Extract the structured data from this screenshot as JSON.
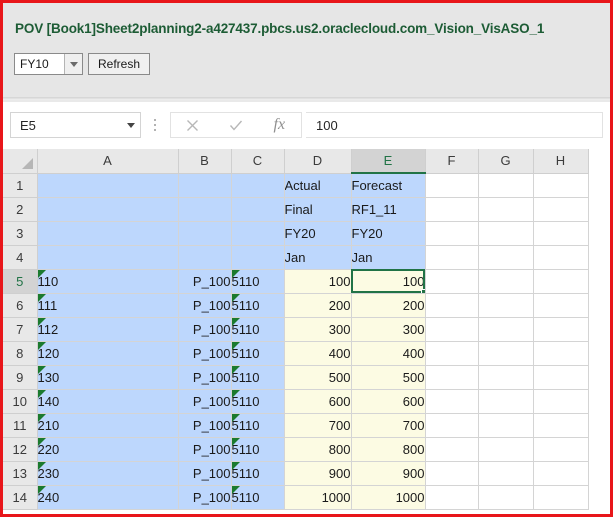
{
  "pov": {
    "title": "POV [Book1]Sheet2planning2-a427437.pbcs.us2.oraclecloud.com_Vision_VisASO_1",
    "combo_value": "FY10",
    "combo_arrow_icon": "chevron-down-icon",
    "refresh_label": "Refresh"
  },
  "formula_bar": {
    "name_box_value": "E5",
    "name_box_arrow_icon": "chevron-down-icon",
    "cancel_icon": "close-icon",
    "enter_icon": "check-icon",
    "function_icon": "fx-icon",
    "formula_value": "100",
    "formula_placeholder": ""
  },
  "grid": {
    "column_headers": [
      "A",
      "B",
      "C",
      "D",
      "E",
      "F",
      "G",
      "H"
    ],
    "selected_column": "E",
    "selected_row": "5",
    "selected_cell": "E5",
    "row_numbers": [
      "1",
      "2",
      "3",
      "4",
      "5",
      "6",
      "7",
      "8",
      "9",
      "10",
      "11",
      "12",
      "13",
      "14"
    ],
    "rows": [
      {
        "num": "1",
        "cells": [
          {
            "col": "A",
            "value": "",
            "fill": "blue",
            "align": "lt",
            "note": false
          },
          {
            "col": "B",
            "value": "",
            "fill": "blue",
            "align": "lt",
            "note": false
          },
          {
            "col": "C",
            "value": "",
            "fill": "blue",
            "align": "lt",
            "note": false
          },
          {
            "col": "D",
            "value": "Actual",
            "fill": "blue",
            "align": "lt",
            "note": false
          },
          {
            "col": "E",
            "value": "Forecast",
            "fill": "blue",
            "align": "lt",
            "note": false
          },
          {
            "col": "F",
            "value": "",
            "fill": "plain",
            "align": "lt",
            "note": false
          },
          {
            "col": "G",
            "value": "",
            "fill": "plain",
            "align": "lt",
            "note": false
          },
          {
            "col": "H",
            "value": "",
            "fill": "plain",
            "align": "lt",
            "note": false
          }
        ]
      },
      {
        "num": "2",
        "cells": [
          {
            "col": "A",
            "value": "",
            "fill": "blue",
            "align": "lt",
            "note": false
          },
          {
            "col": "B",
            "value": "",
            "fill": "blue",
            "align": "lt",
            "note": false
          },
          {
            "col": "C",
            "value": "",
            "fill": "blue",
            "align": "lt",
            "note": false
          },
          {
            "col": "D",
            "value": "Final",
            "fill": "blue",
            "align": "lt",
            "note": false
          },
          {
            "col": "E",
            "value": "RF1_11",
            "fill": "blue",
            "align": "lt",
            "note": false
          },
          {
            "col": "F",
            "value": "",
            "fill": "plain",
            "align": "lt",
            "note": false
          },
          {
            "col": "G",
            "value": "",
            "fill": "plain",
            "align": "lt",
            "note": false
          },
          {
            "col": "H",
            "value": "",
            "fill": "plain",
            "align": "lt",
            "note": false
          }
        ]
      },
      {
        "num": "3",
        "cells": [
          {
            "col": "A",
            "value": "",
            "fill": "blue",
            "align": "lt",
            "note": false
          },
          {
            "col": "B",
            "value": "",
            "fill": "blue",
            "align": "lt",
            "note": false
          },
          {
            "col": "C",
            "value": "",
            "fill": "blue",
            "align": "lt",
            "note": false
          },
          {
            "col": "D",
            "value": "FY20",
            "fill": "blue",
            "align": "lt",
            "note": false
          },
          {
            "col": "E",
            "value": "FY20",
            "fill": "blue",
            "align": "lt",
            "note": false
          },
          {
            "col": "F",
            "value": "",
            "fill": "plain",
            "align": "lt",
            "note": false
          },
          {
            "col": "G",
            "value": "",
            "fill": "plain",
            "align": "lt",
            "note": false
          },
          {
            "col": "H",
            "value": "",
            "fill": "plain",
            "align": "lt",
            "note": false
          }
        ]
      },
      {
        "num": "4",
        "cells": [
          {
            "col": "A",
            "value": "",
            "fill": "blue",
            "align": "lt",
            "note": false
          },
          {
            "col": "B",
            "value": "",
            "fill": "blue",
            "align": "lt",
            "note": false
          },
          {
            "col": "C",
            "value": "",
            "fill": "blue",
            "align": "lt",
            "note": false
          },
          {
            "col": "D",
            "value": "Jan",
            "fill": "blue",
            "align": "lt",
            "note": false
          },
          {
            "col": "E",
            "value": "Jan",
            "fill": "blue",
            "align": "lt",
            "note": false
          },
          {
            "col": "F",
            "value": "",
            "fill": "plain",
            "align": "lt",
            "note": false
          },
          {
            "col": "G",
            "value": "",
            "fill": "plain",
            "align": "lt",
            "note": false
          },
          {
            "col": "H",
            "value": "",
            "fill": "plain",
            "align": "lt",
            "note": false
          }
        ]
      },
      {
        "num": "5",
        "cells": [
          {
            "col": "A",
            "value": "110",
            "fill": "blue",
            "align": "lt",
            "note": true
          },
          {
            "col": "B",
            "value": "P_100",
            "fill": "blue",
            "align": "rt",
            "note": false
          },
          {
            "col": "C",
            "value": "5110",
            "fill": "blue",
            "align": "lt",
            "note": true
          },
          {
            "col": "D",
            "value": "100",
            "fill": "yellow",
            "align": "rt",
            "note": false
          },
          {
            "col": "E",
            "value": "100",
            "fill": "yellow",
            "align": "rt",
            "note": false,
            "selected": true
          },
          {
            "col": "F",
            "value": "",
            "fill": "plain",
            "align": "lt",
            "note": false
          },
          {
            "col": "G",
            "value": "",
            "fill": "plain",
            "align": "lt",
            "note": false
          },
          {
            "col": "H",
            "value": "",
            "fill": "plain",
            "align": "lt",
            "note": false
          }
        ]
      },
      {
        "num": "6",
        "cells": [
          {
            "col": "A",
            "value": "111",
            "fill": "blue",
            "align": "lt",
            "note": true
          },
          {
            "col": "B",
            "value": "P_100",
            "fill": "blue",
            "align": "rt",
            "note": false
          },
          {
            "col": "C",
            "value": "5110",
            "fill": "blue",
            "align": "lt",
            "note": true
          },
          {
            "col": "D",
            "value": "200",
            "fill": "yellow",
            "align": "rt",
            "note": false
          },
          {
            "col": "E",
            "value": "200",
            "fill": "yellow",
            "align": "rt",
            "note": false
          },
          {
            "col": "F",
            "value": "",
            "fill": "plain",
            "align": "lt",
            "note": false
          },
          {
            "col": "G",
            "value": "",
            "fill": "plain",
            "align": "lt",
            "note": false
          },
          {
            "col": "H",
            "value": "",
            "fill": "plain",
            "align": "lt",
            "note": false
          }
        ]
      },
      {
        "num": "7",
        "cells": [
          {
            "col": "A",
            "value": "112",
            "fill": "blue",
            "align": "lt",
            "note": true
          },
          {
            "col": "B",
            "value": "P_100",
            "fill": "blue",
            "align": "rt",
            "note": false
          },
          {
            "col": "C",
            "value": "5110",
            "fill": "blue",
            "align": "lt",
            "note": true
          },
          {
            "col": "D",
            "value": "300",
            "fill": "yellow",
            "align": "rt",
            "note": false
          },
          {
            "col": "E",
            "value": "300",
            "fill": "yellow",
            "align": "rt",
            "note": false
          },
          {
            "col": "F",
            "value": "",
            "fill": "plain",
            "align": "lt",
            "note": false
          },
          {
            "col": "G",
            "value": "",
            "fill": "plain",
            "align": "lt",
            "note": false
          },
          {
            "col": "H",
            "value": "",
            "fill": "plain",
            "align": "lt",
            "note": false
          }
        ]
      },
      {
        "num": "8",
        "cells": [
          {
            "col": "A",
            "value": "120",
            "fill": "blue",
            "align": "lt",
            "note": true
          },
          {
            "col": "B",
            "value": "P_100",
            "fill": "blue",
            "align": "rt",
            "note": false
          },
          {
            "col": "C",
            "value": "5110",
            "fill": "blue",
            "align": "lt",
            "note": true
          },
          {
            "col": "D",
            "value": "400",
            "fill": "yellow",
            "align": "rt",
            "note": false
          },
          {
            "col": "E",
            "value": "400",
            "fill": "yellow",
            "align": "rt",
            "note": false
          },
          {
            "col": "F",
            "value": "",
            "fill": "plain",
            "align": "lt",
            "note": false
          },
          {
            "col": "G",
            "value": "",
            "fill": "plain",
            "align": "lt",
            "note": false
          },
          {
            "col": "H",
            "value": "",
            "fill": "plain",
            "align": "lt",
            "note": false
          }
        ]
      },
      {
        "num": "9",
        "cells": [
          {
            "col": "A",
            "value": "130",
            "fill": "blue",
            "align": "lt",
            "note": true
          },
          {
            "col": "B",
            "value": "P_100",
            "fill": "blue",
            "align": "rt",
            "note": false
          },
          {
            "col": "C",
            "value": "5110",
            "fill": "blue",
            "align": "lt",
            "note": true
          },
          {
            "col": "D",
            "value": "500",
            "fill": "yellow",
            "align": "rt",
            "note": false
          },
          {
            "col": "E",
            "value": "500",
            "fill": "yellow",
            "align": "rt",
            "note": false
          },
          {
            "col": "F",
            "value": "",
            "fill": "plain",
            "align": "lt",
            "note": false
          },
          {
            "col": "G",
            "value": "",
            "fill": "plain",
            "align": "lt",
            "note": false
          },
          {
            "col": "H",
            "value": "",
            "fill": "plain",
            "align": "lt",
            "note": false
          }
        ]
      },
      {
        "num": "10",
        "cells": [
          {
            "col": "A",
            "value": "140",
            "fill": "blue",
            "align": "lt",
            "note": true
          },
          {
            "col": "B",
            "value": "P_100",
            "fill": "blue",
            "align": "rt",
            "note": false
          },
          {
            "col": "C",
            "value": "5110",
            "fill": "blue",
            "align": "lt",
            "note": true
          },
          {
            "col": "D",
            "value": "600",
            "fill": "yellow",
            "align": "rt",
            "note": false
          },
          {
            "col": "E",
            "value": "600",
            "fill": "yellow",
            "align": "rt",
            "note": false
          },
          {
            "col": "F",
            "value": "",
            "fill": "plain",
            "align": "lt",
            "note": false
          },
          {
            "col": "G",
            "value": "",
            "fill": "plain",
            "align": "lt",
            "note": false
          },
          {
            "col": "H",
            "value": "",
            "fill": "plain",
            "align": "lt",
            "note": false
          }
        ]
      },
      {
        "num": "11",
        "cells": [
          {
            "col": "A",
            "value": "210",
            "fill": "blue",
            "align": "lt",
            "note": true
          },
          {
            "col": "B",
            "value": "P_100",
            "fill": "blue",
            "align": "rt",
            "note": false
          },
          {
            "col": "C",
            "value": "5110",
            "fill": "blue",
            "align": "lt",
            "note": true
          },
          {
            "col": "D",
            "value": "700",
            "fill": "yellow",
            "align": "rt",
            "note": false
          },
          {
            "col": "E",
            "value": "700",
            "fill": "yellow",
            "align": "rt",
            "note": false
          },
          {
            "col": "F",
            "value": "",
            "fill": "plain",
            "align": "lt",
            "note": false
          },
          {
            "col": "G",
            "value": "",
            "fill": "plain",
            "align": "lt",
            "note": false
          },
          {
            "col": "H",
            "value": "",
            "fill": "plain",
            "align": "lt",
            "note": false
          }
        ]
      },
      {
        "num": "12",
        "cells": [
          {
            "col": "A",
            "value": "220",
            "fill": "blue",
            "align": "lt",
            "note": true
          },
          {
            "col": "B",
            "value": "P_100",
            "fill": "blue",
            "align": "rt",
            "note": false
          },
          {
            "col": "C",
            "value": "5110",
            "fill": "blue",
            "align": "lt",
            "note": true
          },
          {
            "col": "D",
            "value": "800",
            "fill": "yellow",
            "align": "rt",
            "note": false
          },
          {
            "col": "E",
            "value": "800",
            "fill": "yellow",
            "align": "rt",
            "note": false
          },
          {
            "col": "F",
            "value": "",
            "fill": "plain",
            "align": "lt",
            "note": false
          },
          {
            "col": "G",
            "value": "",
            "fill": "plain",
            "align": "lt",
            "note": false
          },
          {
            "col": "H",
            "value": "",
            "fill": "plain",
            "align": "lt",
            "note": false
          }
        ]
      },
      {
        "num": "13",
        "cells": [
          {
            "col": "A",
            "value": "230",
            "fill": "blue",
            "align": "lt",
            "note": true
          },
          {
            "col": "B",
            "value": "P_100",
            "fill": "blue",
            "align": "rt",
            "note": false
          },
          {
            "col": "C",
            "value": "5110",
            "fill": "blue",
            "align": "lt",
            "note": true
          },
          {
            "col": "D",
            "value": "900",
            "fill": "yellow",
            "align": "rt",
            "note": false
          },
          {
            "col": "E",
            "value": "900",
            "fill": "yellow",
            "align": "rt",
            "note": false
          },
          {
            "col": "F",
            "value": "",
            "fill": "plain",
            "align": "lt",
            "note": false
          },
          {
            "col": "G",
            "value": "",
            "fill": "plain",
            "align": "lt",
            "note": false
          },
          {
            "col": "H",
            "value": "",
            "fill": "plain",
            "align": "lt",
            "note": false
          }
        ]
      },
      {
        "num": "14",
        "cells": [
          {
            "col": "A",
            "value": "240",
            "fill": "blue",
            "align": "lt",
            "note": true
          },
          {
            "col": "B",
            "value": "P_100",
            "fill": "blue",
            "align": "rt",
            "note": false
          },
          {
            "col": "C",
            "value": "5110",
            "fill": "blue",
            "align": "lt",
            "note": true
          },
          {
            "col": "D",
            "value": "1000",
            "fill": "yellow",
            "align": "rt",
            "note": false
          },
          {
            "col": "E",
            "value": "1000",
            "fill": "yellow",
            "align": "rt",
            "note": false
          },
          {
            "col": "F",
            "value": "",
            "fill": "plain",
            "align": "lt",
            "note": false
          },
          {
            "col": "G",
            "value": "",
            "fill": "plain",
            "align": "lt",
            "note": false
          },
          {
            "col": "H",
            "value": "",
            "fill": "plain",
            "align": "lt",
            "note": false
          }
        ]
      }
    ]
  },
  "colors": {
    "border_red": "#e8161a",
    "title_green": "#1d5c35",
    "selection_green": "#217346",
    "member_blue": "#bdd7fd",
    "data_yellow": "#fcfbe3",
    "note_green": "#1b7a2e"
  }
}
